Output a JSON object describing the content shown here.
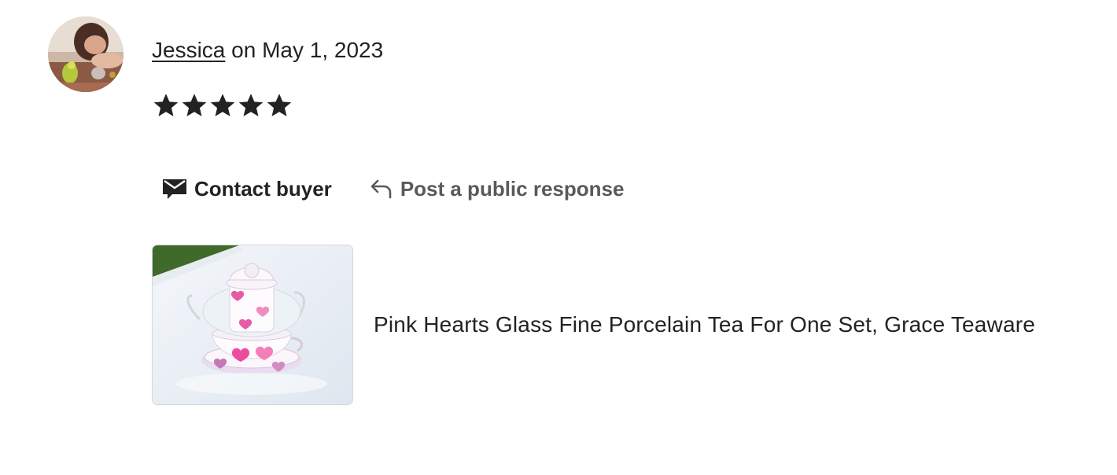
{
  "review": {
    "reviewer_name": "Jessica",
    "date_text": " on May 1, 2023",
    "rating": 5,
    "rating_max": 5
  },
  "actions": {
    "contact_label": "Contact buyer",
    "respond_label": "Post a public response"
  },
  "product": {
    "title": "Pink Hearts Glass Fine Porcelain Tea For One Set, Grace Teaware"
  },
  "icons": {
    "contact": "envelope-icon",
    "respond": "reply-arrow-icon",
    "star": "star-icon"
  },
  "colors": {
    "text": "#222222",
    "muted": "#595959",
    "star": "#222222"
  }
}
